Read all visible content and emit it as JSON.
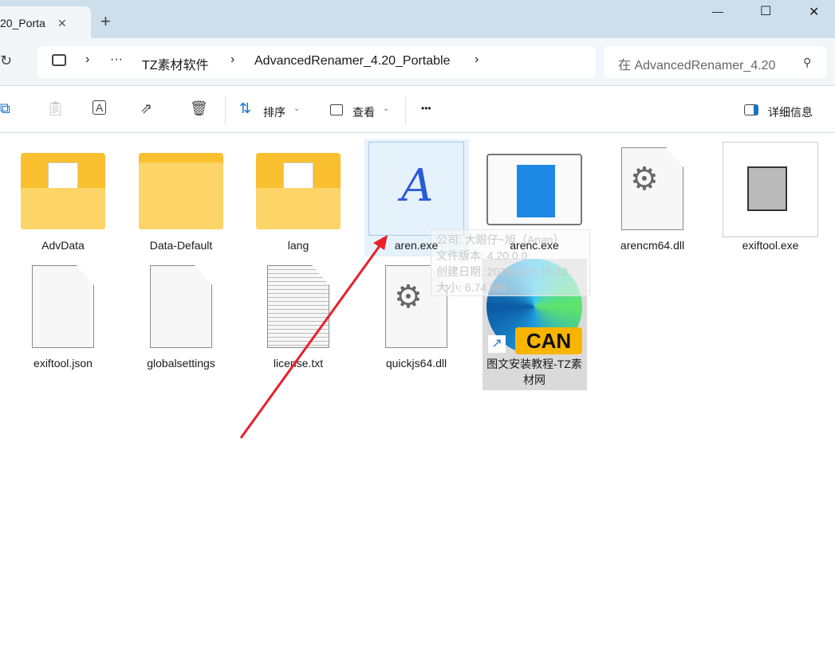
{
  "window": {
    "tab_title": "20_Porta",
    "new_tab": "+",
    "minimize": "—",
    "maximize": "☐",
    "close": "✕"
  },
  "address": {
    "refresh": "↻",
    "ellipsis": "···",
    "crumbs": [
      "TZ素材软件",
      "AdvancedRenamer_4.20_Portable"
    ],
    "sep": "›"
  },
  "search": {
    "placeholder": "在 AdvancedRenamer_4.20"
  },
  "toolbar": {
    "sort": "排序",
    "view": "查看",
    "more": "•••",
    "details": "详细信息"
  },
  "files": [
    {
      "name": "AdvData",
      "type": "folder-doc"
    },
    {
      "name": "Data-Default",
      "type": "folder"
    },
    {
      "name": "lang",
      "type": "folder-doc"
    },
    {
      "name": "aren.exe",
      "type": "exe-aren",
      "selected": true
    },
    {
      "name": "arenc.exe",
      "type": "exe-window"
    },
    {
      "name": "arencm64.dll",
      "type": "dll"
    },
    {
      "name": "exiftool.exe",
      "type": "exe-camel"
    },
    {
      "name": "exiftool.json",
      "type": "file"
    },
    {
      "name": "globalsettings",
      "type": "file"
    },
    {
      "name": "license.txt",
      "type": "text"
    },
    {
      "name": "quickjs64.dll",
      "type": "dll"
    },
    {
      "name": "图文安装教程-TZ素材网",
      "type": "shortcut-edge",
      "badge": "CAN"
    }
  ],
  "tooltip": {
    "lines": [
      "公司: 大眼仔~旭（Anan）",
      "文件版本: 4.20.0.0",
      "创建日期: 2026/1/23 15:12",
      "大小: 6.74 MB"
    ]
  },
  "colors": {
    "titlebar": "#cddfec",
    "selection": "#e5f1fb",
    "arrow": "#e8202a",
    "folder": "#fcc93e"
  }
}
